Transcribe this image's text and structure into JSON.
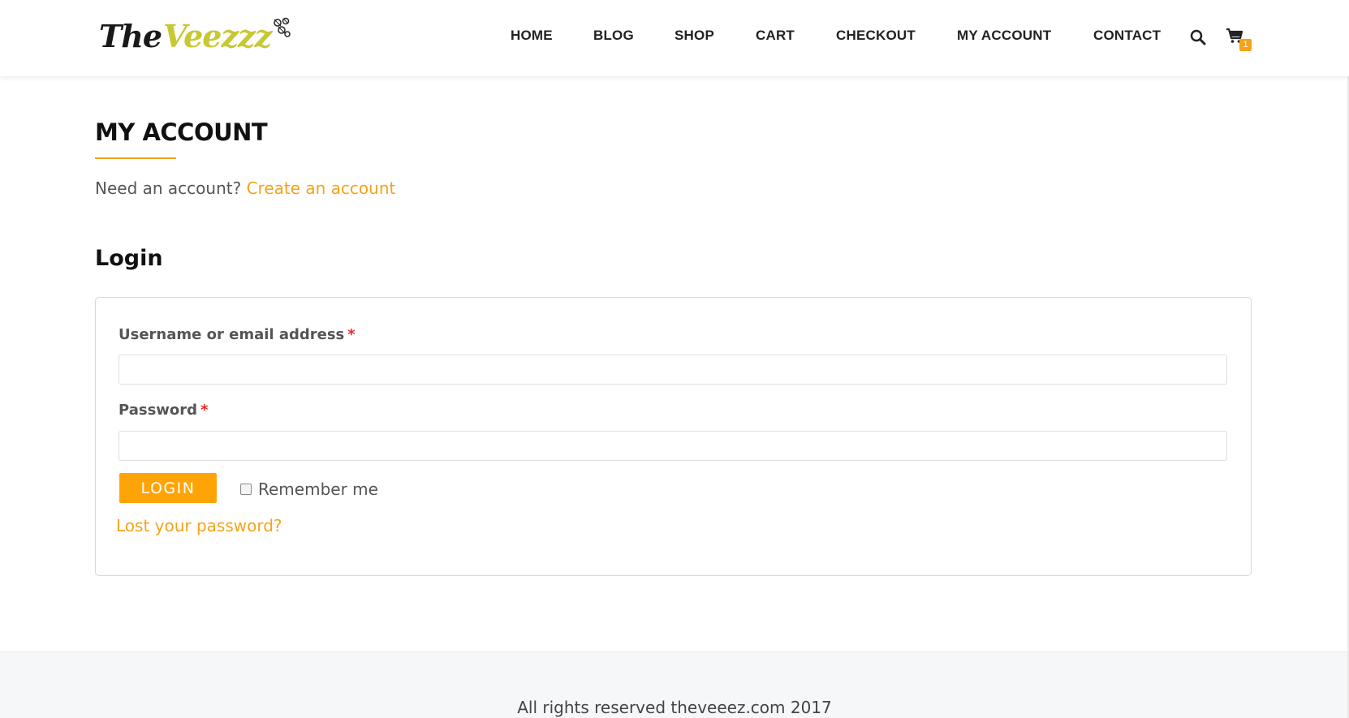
{
  "header": {
    "logo": {
      "part1": "The",
      "part2": "Veezzz",
      "icon": "bees-icon"
    },
    "nav": [
      {
        "label": "HOME"
      },
      {
        "label": "BLOG"
      },
      {
        "label": "SHOP"
      },
      {
        "label": "CART"
      },
      {
        "label": "CHECKOUT"
      },
      {
        "label": "MY ACCOUNT"
      },
      {
        "label": "CONTACT"
      }
    ],
    "search_icon": "search-icon",
    "cart_icon": "cart-icon",
    "cart_count": "1"
  },
  "main": {
    "title": "MY ACCOUNT",
    "need_account_text": "Need an account?",
    "create_account_link": "Create an account",
    "login_heading": "Login",
    "form": {
      "username_label": "Username or email address",
      "password_label": "Password",
      "required_mark": "*",
      "username_value": "",
      "password_value": "",
      "login_button": "LOGIN",
      "remember_label": "Remember me",
      "remember_checked": false,
      "lost_password_link": "Lost your password?"
    }
  },
  "footer": {
    "text": "All rights reserved theveeez.com 2017"
  },
  "colors": {
    "accent": "#f5a31a",
    "button": "#ffa407",
    "logo_green": "#c8c832",
    "required": "#e02b27"
  }
}
